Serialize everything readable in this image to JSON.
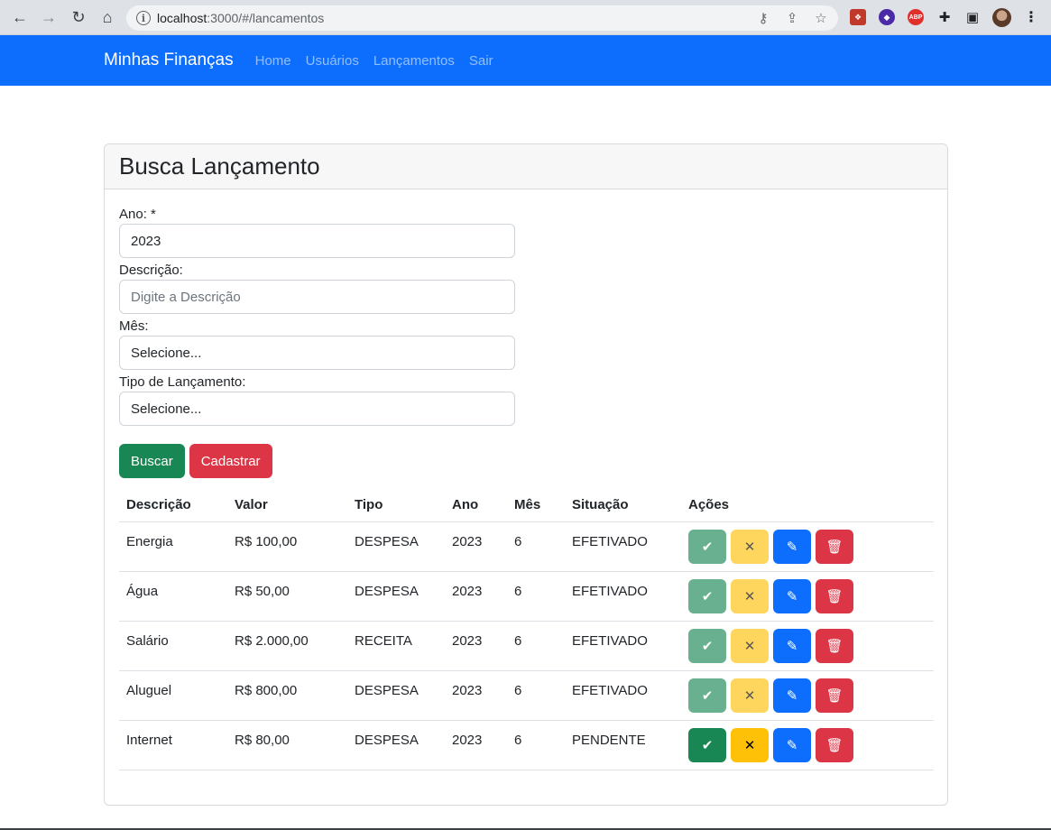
{
  "browser": {
    "url_host": "localhost",
    "url_rest": ":3000/#/lancamentos"
  },
  "navbar": {
    "brand": "Minhas Finanças",
    "links": [
      "Home",
      "Usuários",
      "Lançamentos",
      "Sair"
    ]
  },
  "card": {
    "title": "Busca Lançamento",
    "form": {
      "ano_label": "Ano: *",
      "ano_value": "2023",
      "descricao_label": "Descrição:",
      "descricao_placeholder": "Digite a Descrição",
      "mes_label": "Mês:",
      "mes_value": "Selecione...",
      "tipo_label": "Tipo de Lançamento:",
      "tipo_value": "Selecione..."
    },
    "buttons": {
      "buscar": "Buscar",
      "cadastrar": "Cadastrar"
    },
    "table": {
      "headers": [
        "Descrição",
        "Valor",
        "Tipo",
        "Ano",
        "Mês",
        "Situação",
        "Ações"
      ],
      "rows": [
        {
          "descricao": "Energia",
          "valor": "R$ 100,00",
          "tipo": "DESPESA",
          "ano": "2023",
          "mes": "6",
          "situacao": "EFETIVADO"
        },
        {
          "descricao": "Água",
          "valor": "R$ 50,00",
          "tipo": "DESPESA",
          "ano": "2023",
          "mes": "6",
          "situacao": "EFETIVADO"
        },
        {
          "descricao": "Salário",
          "valor": "R$ 2.000,00",
          "tipo": "RECEITA",
          "ano": "2023",
          "mes": "6",
          "situacao": "EFETIVADO"
        },
        {
          "descricao": "Aluguel",
          "valor": "R$ 800,00",
          "tipo": "DESPESA",
          "ano": "2023",
          "mes": "6",
          "situacao": "EFETIVADO"
        },
        {
          "descricao": "Internet",
          "valor": "R$ 80,00",
          "tipo": "DESPESA",
          "ano": "2023",
          "mes": "6",
          "situacao": "PENDENTE"
        }
      ]
    }
  },
  "colors": {
    "primary": "#0d6efd",
    "success": "#198754",
    "warning": "#ffc107",
    "danger": "#dc3545"
  }
}
